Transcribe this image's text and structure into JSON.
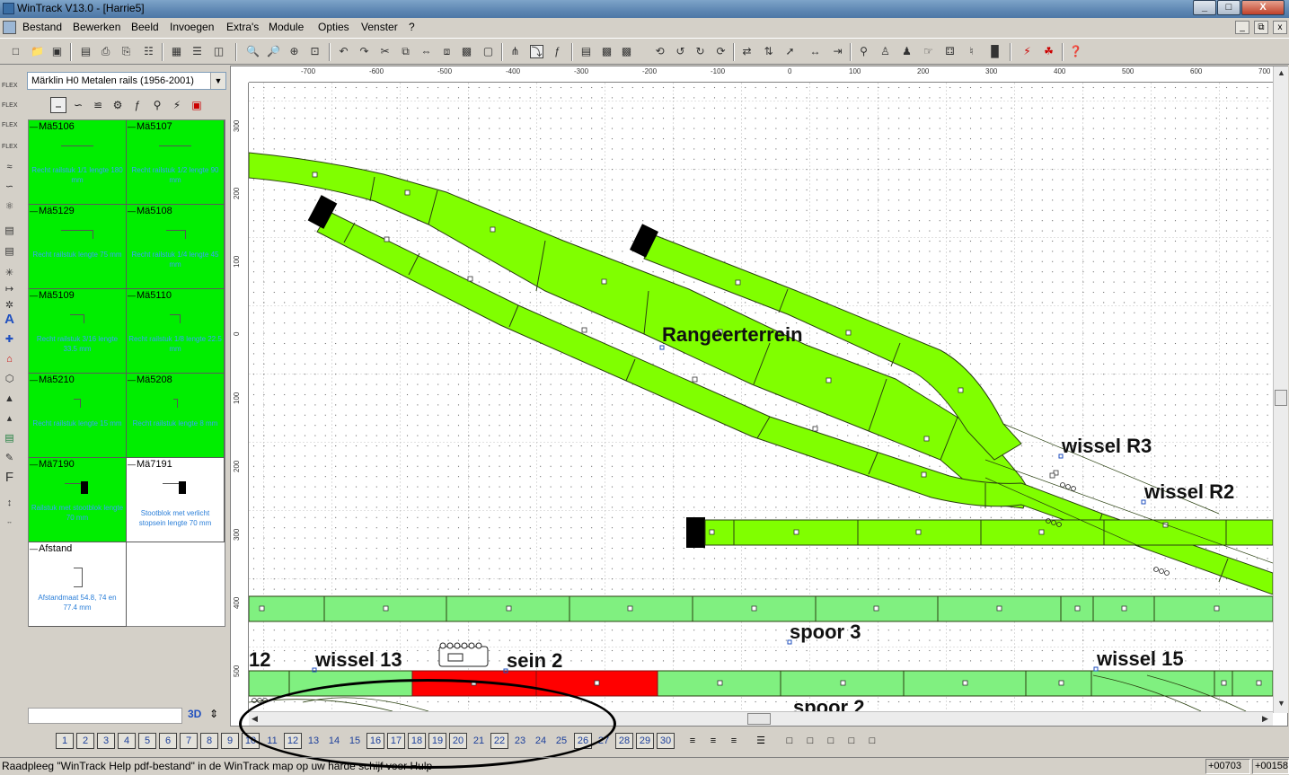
{
  "window": {
    "title": "WinTrack  V13.0 - [Harrie5]",
    "min": "_",
    "max": "□",
    "close": "X"
  },
  "menu": [
    "Bestand",
    "Bewerken",
    "Beeld",
    "Invoegen",
    "Extra's",
    "Module",
    "Opties",
    "Venster",
    "?"
  ],
  "mdi_controls": [
    "_",
    "⧉",
    "x"
  ],
  "catalog": {
    "library": "Märklin H0 Metalen rails (1956-2001)",
    "tiles": [
      {
        "code": "Mä5106",
        "desc": "Recht railstuk 1/1 lengte 180 mm",
        "style": "green"
      },
      {
        "code": "Mä5107",
        "desc": "Recht railstuk 1/2 lengte 90 mm",
        "style": "green"
      },
      {
        "code": "Mä5129",
        "desc": "Recht railstuk lengte 75 mm",
        "style": "green"
      },
      {
        "code": "Mä5108",
        "desc": "Recht railstuk 1/4 lengte 45 mm",
        "style": "green"
      },
      {
        "code": "Mä5109",
        "desc": "Recht railstuk 3/16 lengte 33.5 mm",
        "style": "green"
      },
      {
        "code": "Mä5110",
        "desc": "Recht railstuk 1/8 lengte 22.5 mm",
        "style": "green"
      },
      {
        "code": "Mä5210",
        "desc": "Recht railstuk lengte 15 mm",
        "style": "green"
      },
      {
        "code": "Mä5208",
        "desc": "Recht railstuk lengte 8 mm",
        "style": "green"
      },
      {
        "code": "Mä7190",
        "desc": "Railstuk met stootblok lengte 70 mm",
        "style": "green"
      },
      {
        "code": "Mä7191",
        "desc": "Stootblok met verlicht stopsein lengte 70 mm",
        "style": "white"
      },
      {
        "code": "Afstand",
        "desc": "Afstandmaat 54.8, 74 en 77.4 mm",
        "style": "white"
      }
    ],
    "btn_3d": "3D"
  },
  "rulers": {
    "top": [
      "-700",
      "-600",
      "-500",
      "-400",
      "-300",
      "-200",
      "-100",
      "0",
      "100",
      "200",
      "300",
      "400",
      "500",
      "600",
      "700"
    ],
    "left": [
      "300",
      "200",
      "100",
      "0",
      "100",
      "200",
      "300",
      "400",
      "500"
    ]
  },
  "layout": {
    "labels": {
      "rangeer": "Rangeerterrein",
      "wissel_r3": "wissel R3",
      "wissel_r2": "wissel R2",
      "spoor3": "spoor 3",
      "n12": "12",
      "wissel13": "wissel 13",
      "sein2": "sein 2",
      "wissel15": "wissel 15",
      "spoor2": "spoor 2"
    },
    "colors": {
      "track": "#80ff00",
      "track_light": "#80f080",
      "track_selected": "#ff0000",
      "bumper": "#000000"
    }
  },
  "layers": [
    "1",
    "2",
    "3",
    "4",
    "5",
    "6",
    "7",
    "8",
    "9",
    "10",
    "11",
    "12",
    "13",
    "14",
    "15",
    "16",
    "17",
    "18",
    "19",
    "20",
    "21",
    "22",
    "23",
    "24",
    "25",
    "26",
    "27",
    "28",
    "29",
    "30"
  ],
  "status": {
    "message": "Raadpleeg \"WinTrack Help pdf-bestand\" in de WinTrack map op uw harde schijf voor Hulp",
    "coord_x": "+00703",
    "coord_y": "+00158"
  }
}
